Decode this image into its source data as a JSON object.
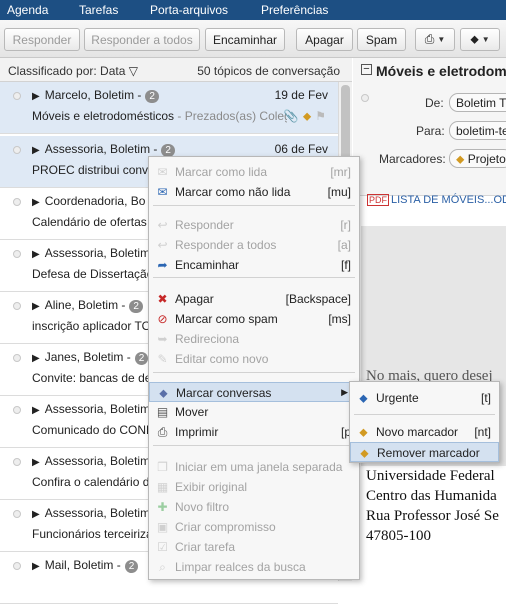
{
  "topmenu": [
    "Agenda",
    "Tarefas",
    "Porta-arquivos",
    "Preferências"
  ],
  "toolbar": {
    "reply": "Responder",
    "reply_all": "Responder a todos",
    "forward": "Encaminhar",
    "delete": "Apagar",
    "spam": "Spam"
  },
  "list": {
    "sort_label": "Classificado por: Data",
    "count_label": "50 tópicos de conversação",
    "rows": [
      {
        "sender": "Marcelo, Boletim -",
        "badge": "2",
        "date": "19 de Fev",
        "subject": "Móveis e eletrodomésticos",
        "preview": " - Prezados(as) Coleg",
        "selected": true
      },
      {
        "sender": "Assessoria, Boletim -",
        "badge": "2",
        "date": "06 de Fev",
        "subject": "PROEC distribui convite",
        "preview": "",
        "selected": true
      },
      {
        "sender": "Coordenadoria, Bo",
        "badge": "",
        "date": "",
        "subject": "Calendário de ofertas",
        "preview": "",
        "selected": false
      },
      {
        "sender": "Assessoria, Boletim",
        "badge": "",
        "date": "",
        "subject": "Defesa de Dissertação",
        "preview": "",
        "selected": false
      },
      {
        "sender": "Aline, Boletim -",
        "badge": "2",
        "date": "",
        "subject": "inscrição aplicador TOI",
        "preview": "",
        "selected": false
      },
      {
        "sender": "Janes, Boletim -",
        "badge": "2",
        "date": "",
        "subject": "Convite: bancas de def",
        "preview": "",
        "selected": false
      },
      {
        "sender": "Assessoria, Boletim",
        "badge": "",
        "date": "",
        "subject": "Comunicado do CONE",
        "preview": "",
        "selected": false
      },
      {
        "sender": "Assessoria, Boletim",
        "badge": "",
        "date": "",
        "subject": "Confira o calendário d",
        "preview": "",
        "selected": false
      },
      {
        "sender": "Assessoria, Boletim",
        "badge": "",
        "date": "",
        "subject": "Funcionários terceiriza",
        "preview": "",
        "selected": false
      },
      {
        "sender": "Mail, Boletim -",
        "badge": "2",
        "date": "",
        "subject": "",
        "preview": "",
        "selected": false
      }
    ]
  },
  "reading": {
    "title": "Móveis e eletrodom",
    "from_label": "De:",
    "from_value": "Boletim Té",
    "to_label": "Para:",
    "to_value": "boletim-te",
    "tags_label": "Marcadores:",
    "tag_value": "Projeto",
    "attachment": "LISTA DE MÓVEIS...ODO",
    "attachment_type": "PDF",
    "body_lines": [
      "No mais, quero desej",
      "Universidade Federal",
      "Centro das Humanida",
      "Rua Professor José Se",
      "47805-100"
    ]
  },
  "context_menu": {
    "items": [
      {
        "label": "Marcar como lida",
        "shortcut": "[mr]",
        "icon": "mail-read-icon",
        "glyph": "✉",
        "disabled": true
      },
      {
        "label": "Marcar como não lida",
        "shortcut": "[mu]",
        "icon": "mail-unread-icon",
        "glyph": "✉",
        "disabled": false
      },
      {
        "label": "Responder",
        "shortcut": "[r]",
        "icon": "reply-icon",
        "glyph": "↩",
        "disabled": true
      },
      {
        "label": "Responder a todos",
        "shortcut": "[a]",
        "icon": "reply-all-icon",
        "glyph": "↩",
        "disabled": true
      },
      {
        "label": "Encaminhar",
        "shortcut": "[f]",
        "icon": "forward-icon",
        "glyph": "➦",
        "disabled": false
      },
      {
        "label": "Apagar",
        "shortcut": "[Backspace]",
        "icon": "delete-icon",
        "glyph": "✖",
        "disabled": false
      },
      {
        "label": "Marcar como spam",
        "shortcut": "[ms]",
        "icon": "spam-icon",
        "glyph": "⊘",
        "disabled": false
      },
      {
        "label": "Redireciona",
        "shortcut": "",
        "icon": "redirect-icon",
        "glyph": "➥",
        "disabled": true
      },
      {
        "label": "Editar como novo",
        "shortcut": "",
        "icon": "edit-icon",
        "glyph": "✎",
        "disabled": true
      },
      {
        "label": "Marcar conversas",
        "shortcut": "",
        "icon": "tag-icon",
        "glyph": "⬥",
        "disabled": false
      },
      {
        "label": "Mover",
        "shortcut": "",
        "icon": "move-icon",
        "glyph": "▤",
        "disabled": false
      },
      {
        "label": "Imprimir",
        "shortcut": "[p",
        "icon": "print-icon",
        "glyph": "⎙",
        "disabled": false
      },
      {
        "label": "Iniciar em uma janela separada",
        "shortcut": "",
        "icon": "new-window-icon",
        "glyph": "❐",
        "disabled": true
      },
      {
        "label": "Exibir original",
        "shortcut": "",
        "icon": "show-original-icon",
        "glyph": "▦",
        "disabled": true
      },
      {
        "label": "Novo filtro",
        "shortcut": "",
        "icon": "filter-icon",
        "glyph": "✚",
        "disabled": true
      },
      {
        "label": "Criar compromisso",
        "shortcut": "",
        "icon": "calendar-icon",
        "glyph": "▣",
        "disabled": true
      },
      {
        "label": "Criar tarefa",
        "shortcut": "",
        "icon": "task-icon",
        "glyph": "☑",
        "disabled": true
      },
      {
        "label": "Limpar realces da busca",
        "shortcut": "",
        "icon": "search-icon",
        "glyph": "⌕",
        "disabled": true
      }
    ]
  },
  "tag_submenu": {
    "items": [
      {
        "label": "Urgente",
        "shortcut": "[t]",
        "icon": "tag-urgent-icon",
        "glyph": "⬥"
      },
      {
        "label": "Novo marcador",
        "shortcut": "[nt]",
        "icon": "new-tag-icon",
        "glyph": "⬥"
      },
      {
        "label": "Remover marcador",
        "shortcut": "",
        "icon": "remove-tag-icon",
        "glyph": "⬥"
      }
    ]
  }
}
